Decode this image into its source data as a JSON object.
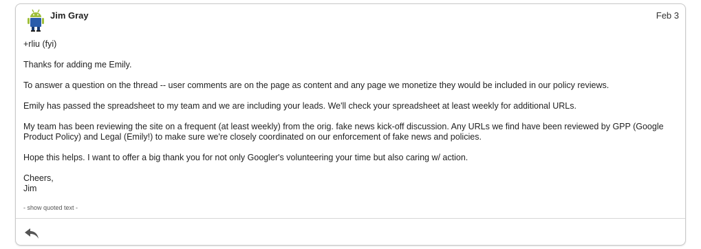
{
  "message": {
    "sender": "Jim Gray",
    "date": "Feb 3",
    "body": [
      "+rliu (fyi)",
      "Thanks for adding me Emily.",
      "To answer a question on the thread -- user comments are on the page as content and any page we monetize they would be included in our policy reviews.",
      "Emily has passed the spreadsheet to my team and we are including your leads. We'll check your spreadsheet at least weekly for additional URLs.",
      "My team has been reviewing the site on a frequent (at least weekly) from the orig. fake news kick-off discussion. Any URLs we find have been reviewed by GPP (Google Product Policy) and Legal (Emily!) to make sure we're closely coordinated on our enforcement of fake news and policies.",
      "Hope this helps. I want to offer a big thank you for not only Googler's volunteering your time but also caring w/ action."
    ],
    "signoff": "Cheers,",
    "signature": "Jim",
    "show_quoted": "- show quoted text -"
  },
  "icons": {
    "avatar": "android-robot-avatar",
    "reply": "reply-arrow-icon"
  },
  "colors": {
    "border": "#c8c8c8",
    "avatar_green": "#9fbf3b",
    "avatar_blue": "#2a5cab",
    "reply_icon": "#555555"
  }
}
